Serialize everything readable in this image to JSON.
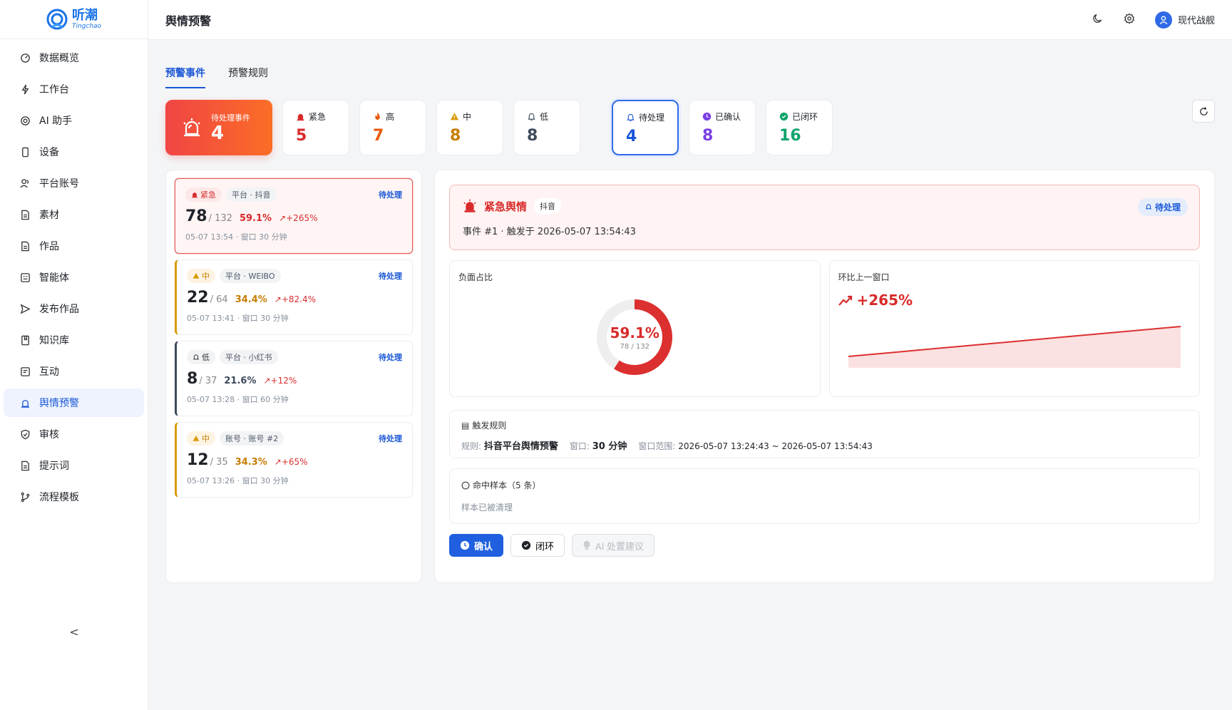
{
  "app": {
    "name_cn": "听潮",
    "name_en": "Tingchao"
  },
  "sidebar": {
    "items": [
      {
        "label": "数据概览"
      },
      {
        "label": "工作台"
      },
      {
        "label": "AI 助手"
      },
      {
        "label": "设备"
      },
      {
        "label": "平台账号"
      },
      {
        "label": "素材"
      },
      {
        "label": "作品"
      },
      {
        "label": "智能体"
      },
      {
        "label": "发布作品"
      },
      {
        "label": "知识库"
      },
      {
        "label": "互动"
      },
      {
        "label": "舆情预警"
      },
      {
        "label": "审核"
      },
      {
        "label": "提示词"
      },
      {
        "label": "流程模板"
      }
    ],
    "collapse": "<"
  },
  "header": {
    "title": "舆情预警",
    "user": "现代战舰"
  },
  "tabs": [
    {
      "label": "预警事件"
    },
    {
      "label": "预警规则"
    }
  ],
  "stats": {
    "hero": {
      "label": "待处理事件",
      "value": "4"
    },
    "levels": [
      {
        "label": "紧急",
        "value": "5",
        "color": "#d92a2a"
      },
      {
        "label": "高",
        "value": "7",
        "color": "#e8590c"
      },
      {
        "label": "中",
        "value": "8",
        "color": "#c77d00"
      },
      {
        "label": "低",
        "value": "8",
        "color": "#3d4a5c"
      }
    ],
    "states": [
      {
        "label": "待处理",
        "value": "4",
        "color": "#1a57d6"
      },
      {
        "label": "已确认",
        "value": "8",
        "color": "#7b3fe4"
      },
      {
        "label": "已闭环",
        "value": "16",
        "color": "#10a36b"
      }
    ]
  },
  "events": [
    {
      "level": "紧急",
      "scope": "平台 · 抖音",
      "status": "待处理",
      "hits": "78",
      "total": "/ 132",
      "pct": "59.1%",
      "trend": "+265%",
      "time": "05-07 13:54 · 窗口 30 分钟"
    },
    {
      "level": "中",
      "scope": "平台 · WEIBO",
      "status": "待处理",
      "hits": "22",
      "total": "/ 64",
      "pct": "34.4%",
      "trend": "+82.4%",
      "time": "05-07 13:41 · 窗口 30 分钟"
    },
    {
      "level": "低",
      "scope": "平台 · 小红书",
      "status": "待处理",
      "hits": "8",
      "total": "/ 37",
      "pct": "21.6%",
      "trend": "+12%",
      "time": "05-07 13:28 · 窗口 60 分钟"
    },
    {
      "level": "中",
      "scope": "账号 · 账号 #2",
      "status": "待处理",
      "hits": "12",
      "total": "/ 35",
      "pct": "34.3%",
      "trend": "+65%",
      "time": "05-07 13:26 · 窗口 30 分钟"
    }
  ],
  "detail": {
    "title": "紧急舆情",
    "platform": "抖音",
    "status": "待处理",
    "subtitle": "事件 #1 · 触发于 2026-05-07 13:54:43",
    "neg_label": "负面占比",
    "neg_pct": "59.1%",
    "neg_fraction": 0.591,
    "neg_sub": "78 / 132",
    "growth_label": "环比上一窗口",
    "growth": "+265%",
    "rule_title": "触发规则",
    "rule_key": "规则:",
    "rule_name": "抖音平台舆情预警",
    "window_key": "窗口:",
    "window_val": "30 分钟",
    "range_key": "窗口范围:",
    "range_val": "2026-05-07 13:24:43 ~ 2026-05-07 13:54:43",
    "sample_title": "命中样本（5 条）",
    "sample_sub": "样本已被清理"
  },
  "actions": {
    "confirm": "确认",
    "close": "闭环",
    "ai": "AI 处置建议"
  }
}
